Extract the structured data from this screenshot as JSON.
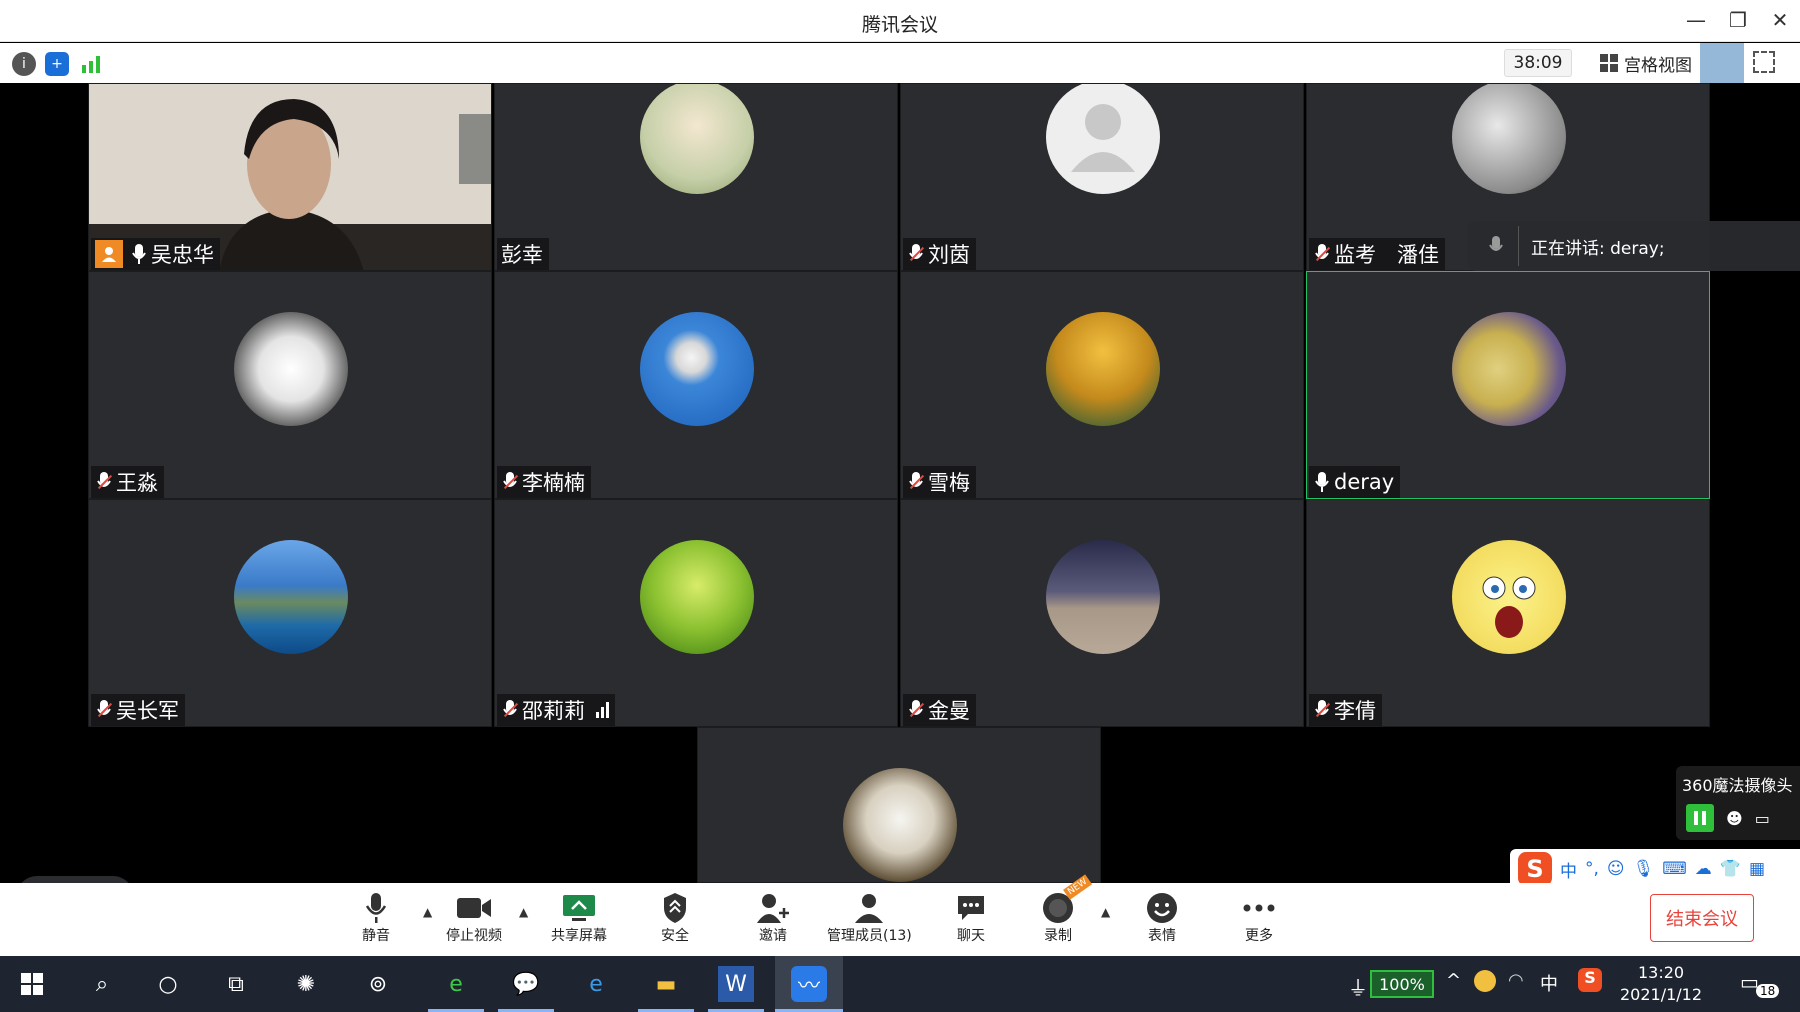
{
  "window": {
    "title": "腾讯会议"
  },
  "infobar": {
    "timer": "38:09",
    "view_label": "宫格视图"
  },
  "speaking": {
    "label": "正在讲话: deray;"
  },
  "participants": [
    {
      "name": "吴忠华"
    },
    {
      "name": "彭幸"
    },
    {
      "name": "刘茵"
    },
    {
      "name": "监考　潘佳"
    },
    {
      "name": "王淼"
    },
    {
      "name": "李楠楠"
    },
    {
      "name": "雪梅"
    },
    {
      "name": "deray"
    },
    {
      "name": "吴长军"
    },
    {
      "name": "邵莉莉"
    },
    {
      "name": "金曼"
    },
    {
      "name": "李倩"
    }
  ],
  "camera_widget": {
    "title": "360魔法摄像头"
  },
  "ime": {
    "mode": "中"
  },
  "toolbar": {
    "mute": "静音",
    "stop_video": "停止视频",
    "share": "共享屏幕",
    "security": "安全",
    "invite": "邀请",
    "members": "管理成员(13)",
    "chat": "聊天",
    "record": "录制",
    "emoji": "表情",
    "more": "更多",
    "end": "结束会议"
  },
  "taskbar": {
    "battery": "100%",
    "time": "13:20",
    "date": "2021/1/12",
    "notifications": "18",
    "lang": "中"
  },
  "colors": {
    "accent_green": "#23c264",
    "end_red": "#e8433b"
  }
}
